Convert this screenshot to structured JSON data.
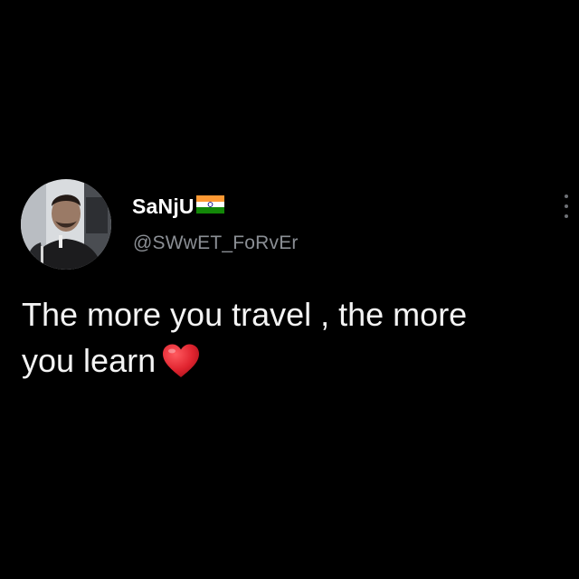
{
  "tweet": {
    "author": {
      "display_name": "SaNjU",
      "flag_icon": "india-flag-icon",
      "handle": "@SWwET_FoRvEr"
    },
    "text_line1": "The more you travel , the more",
    "text_line2": "you learn",
    "emoji_icon": "red-heart-icon",
    "menu_icon": "more-options-icon"
  },
  "colors": {
    "background": "#000000",
    "text": "#f4f4f4",
    "handle": "#8b8f95",
    "heart": "#e0242f",
    "flag_saffron": "#ff9933",
    "flag_green": "#138808",
    "flag_chakra": "#000080"
  }
}
